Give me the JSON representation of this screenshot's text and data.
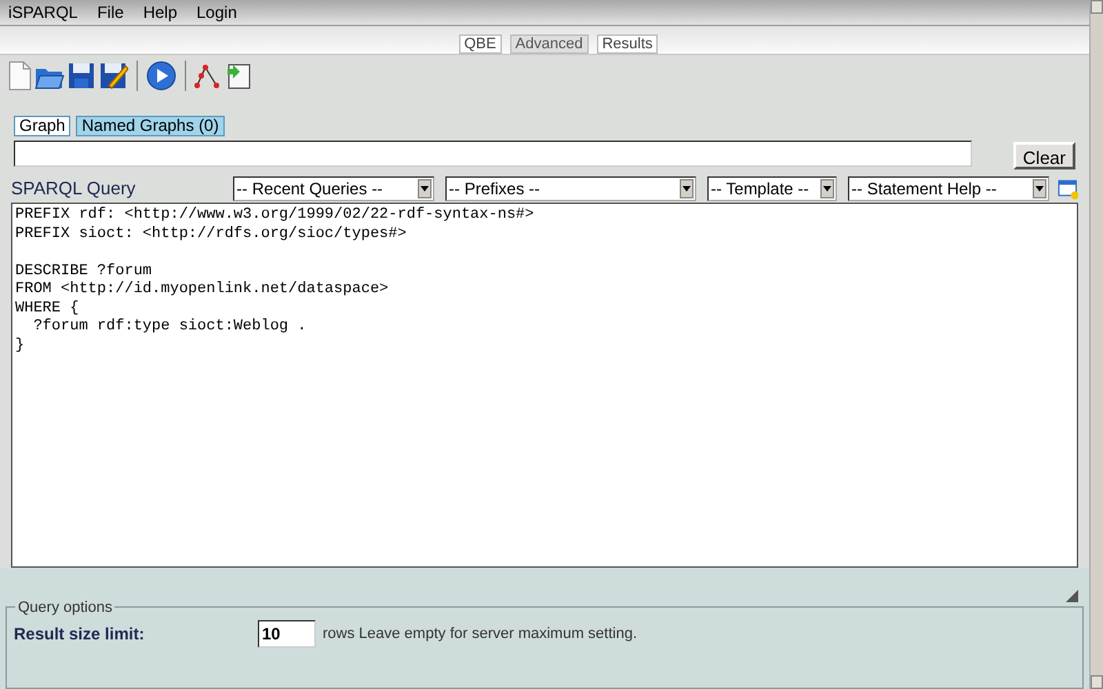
{
  "menu": [
    "iSPARQL",
    "File",
    "Help",
    "Login"
  ],
  "view_tabs": [
    {
      "label": "QBE",
      "selected": false
    },
    {
      "label": "Advanced",
      "selected": true
    },
    {
      "label": "Results",
      "selected": false
    }
  ],
  "graph_tabs": [
    {
      "label": "Graph",
      "selected": true
    },
    {
      "label": "Named Graphs (0)",
      "selected": false
    }
  ],
  "clear_button": "Clear",
  "query": {
    "title": "SPARQL Query",
    "selects": [
      "-- Recent Queries --",
      "-- Prefixes --",
      "-- Template --",
      "-- Statement Help --"
    ],
    "text": "PREFIX rdf: <http://www.w3.org/1999/02/22-rdf-syntax-ns#>\nPREFIX sioct: <http://rdfs.org/sioc/types#>\n\nDESCRIBE ?forum\nFROM <http://id.myopenlink.net/dataspace>\nWHERE {\n  ?forum rdf:type sioct:Weblog .\n}"
  },
  "query_options": {
    "legend": "Query options",
    "label": "Result size limit:",
    "value": "10",
    "note": "rows Leave empty for server maximum setting."
  }
}
